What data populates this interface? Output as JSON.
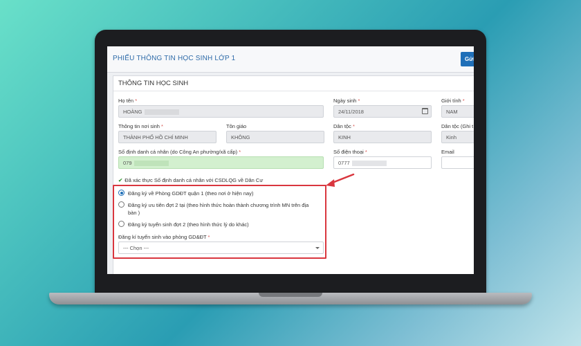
{
  "header": {
    "title": "PHIẾU THÔNG TIN HỌC SINH LỚP 1",
    "send_button": "Gửi"
  },
  "section": {
    "title": "THÔNG TIN HỌC SINH"
  },
  "fields": {
    "ho_ten": {
      "label": "Họ tên",
      "value": "HOÀNG"
    },
    "ngay_sinh": {
      "label": "Ngày sinh",
      "value": "24/11/2018"
    },
    "gioi_tinh": {
      "label": "Giới tính",
      "value": "NAM"
    },
    "noi_sinh": {
      "label": "Thông tin nơi sinh",
      "value": "THÀNH PHỐ HỒ CHÍ MINH"
    },
    "ton_giao": {
      "label": "Tôn giáo",
      "value": "KHÔNG"
    },
    "dan_toc": {
      "label": "Dân tộc",
      "value": "KINH"
    },
    "dan_toc_ghi": {
      "label": "Dân tộc (Ghi t",
      "value": "Kinh"
    },
    "so_dinh_danh": {
      "label": "Số định danh cá nhân (do Công An phường/xã cấp)",
      "value": "079"
    },
    "so_dien_thoai": {
      "label": "Số điện thoại",
      "value": "0777"
    },
    "email": {
      "label": "Email",
      "value": ""
    }
  },
  "required_mark": "*",
  "verified_text": "Đã xác thực Số định danh cá nhân với CSDLQG về Dân Cư",
  "radio_options": [
    {
      "label": "Đăng ký về Phòng GDĐT quận 1 (theo nơi ở hiện nay)",
      "selected": true
    },
    {
      "label": "Đăng ký ưu tiên đợt 2 tại (theo hình thức hoàn thành chương trình MN trên địa bàn )",
      "selected": false
    },
    {
      "label": "Đăng ký tuyển sinh đợt 2 (theo hình thức lý do khác)",
      "selected": false
    }
  ],
  "dropdown": {
    "label": "Đăng kí tuyển sinh vào phòng GD&ĐT",
    "value": "--- Chọn ---"
  },
  "colors": {
    "accent": "#1f6fb8",
    "highlight": "#d9363e",
    "verified_field": "#d3f0cf"
  }
}
